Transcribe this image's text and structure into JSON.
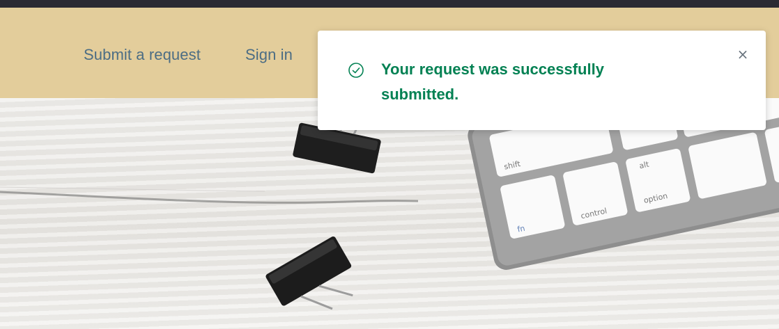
{
  "nav": {
    "submit_request": "Submit a request",
    "sign_in": "Sign in"
  },
  "notification": {
    "message": "Your request was successfully submitted.",
    "close_symbol": "×",
    "icon": "check-circle-icon",
    "accent_color": "#038153"
  },
  "keyboard_keys": {
    "shift": "shift",
    "alt": "alt",
    "option": "option",
    "control": "control",
    "fn": "fn"
  },
  "colors": {
    "header_bg": "#e3cd9b",
    "top_strip": "#2b2a33",
    "nav_link": "#4c6d84"
  }
}
